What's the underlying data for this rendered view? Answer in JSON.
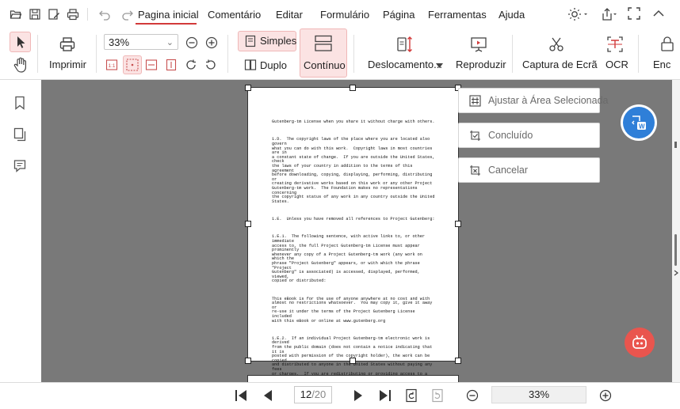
{
  "menu": {
    "items": [
      {
        "key": "home",
        "label": "Pagina inicial",
        "active": true
      },
      {
        "key": "comment",
        "label": "Comentário"
      },
      {
        "key": "edit",
        "label": "Editar"
      },
      {
        "key": "form",
        "label": "Formulário"
      },
      {
        "key": "page",
        "label": "Página"
      },
      {
        "key": "tools",
        "label": "Ferramentas"
      },
      {
        "key": "help",
        "label": "Ajuda"
      }
    ],
    "quick_icons": [
      "folder-open-icon",
      "save-icon",
      "edit-save-icon",
      "print-icon",
      "undo-icon",
      "redo-icon"
    ],
    "window_icons": [
      "theme-icon",
      "share-icon",
      "fullscreen-icon",
      "collapse-icon"
    ]
  },
  "toolbar": {
    "print_label": "Imprimir",
    "zoom_value": "33%",
    "single_label": "Simples",
    "double_label": "Duplo",
    "continuous_label": "Contínuo",
    "scroll_label": "Deslocamento...",
    "play_label": "Reproduzir",
    "capture_label": "Captura de Ecrã",
    "ocr_label": "OCR",
    "cut_label": "Enc"
  },
  "document": {
    "paragraphs": [
      "Gutenberg-tm License when you share it without charge with others.",
      "1.D.  The copyright laws of the place where you are located also govern\nwhat you can do with this work.  Copyright laws in most countries are in\na constant state of change.  If you are outside the United States, check\nthe laws of your country in addition to the terms of this agreement\nbefore downloading, copying, displaying, performing, distributing or\ncreating derivative works based on this work or any other Project\nGutenberg-tm work.  The Foundation makes no representations concerning\nthe copyright status of any work in any country outside the United\nStates.",
      "1.E.  Unless you have removed all references to Project Gutenberg:",
      "1.E.1.  The following sentence, with active links to, or other immediate\naccess to, the full Project Gutenberg-tm License must appear prominently\nwhenever any copy of a Project Gutenberg-tm work (any work on which the\nphrase \"Project Gutenberg\" appears, or with which the phrase \"Project\nGutenberg\" is associated) is accessed, displayed, performed, viewed,\ncopied or distributed:",
      "This eBook is for the use of anyone anywhere at no cost and with\nalmost no restrictions whatsoever.  You may copy it, give it away or\nre-use it under the terms of the Project Gutenberg License included\nwith this eBook or online at www.gutenberg.org",
      "1.E.2.  If an individual Project Gutenberg-tm electronic work is derived\nfrom the public domain (does not contain a notice indicating that it is\nposted with permission of the copyright holder), the work can be copied\nand distributed to anyone in the United States without paying any fees\nor charges.  If you are redistributing or providing access to a work"
    ]
  },
  "crop_panel": {
    "fit_label": "Ajustar à Área Selecionada",
    "done_label": "Concluído",
    "cancel_label": "Cancelar"
  },
  "navigation": {
    "current_page": "12",
    "total_pages": "/20",
    "zoom": "33%"
  },
  "colors": {
    "accent": "#d23a3a",
    "canvas": "#797979",
    "float_blue": "#2f7fd8",
    "float_red": "#e9554e"
  }
}
